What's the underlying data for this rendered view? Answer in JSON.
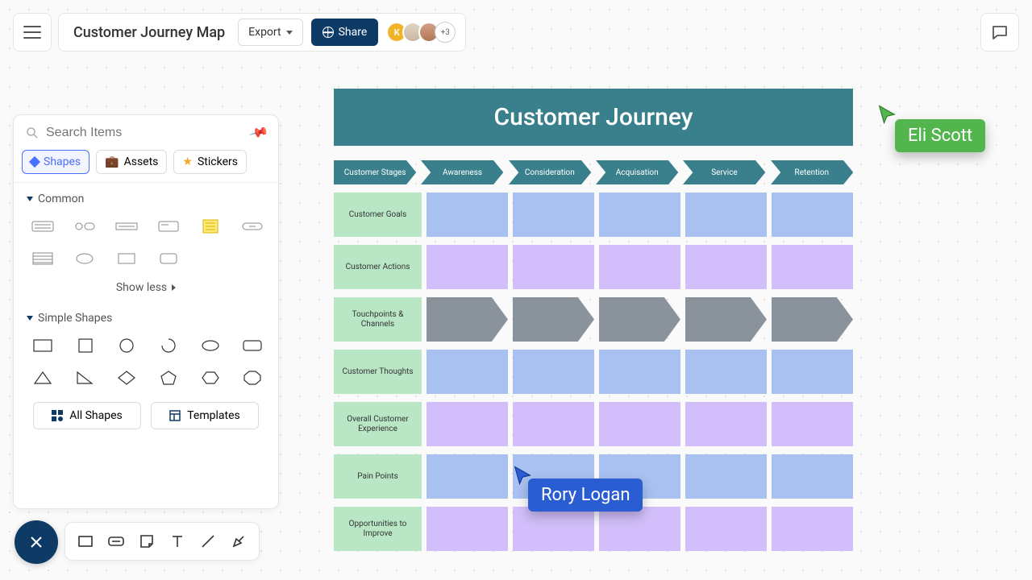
{
  "header": {
    "doc_title": "Customer Journey Map",
    "export_label": "Export",
    "share_label": "Share",
    "more_count": "+3",
    "avatars": [
      {
        "letter": "K",
        "bg": "#f0b429"
      },
      {
        "letter": "",
        "bg": "#d9cbb8"
      },
      {
        "letter": "",
        "bg": "#c98f73"
      }
    ]
  },
  "sidepanel": {
    "search_placeholder": "Search Items",
    "tabs": {
      "shapes": "Shapes",
      "assets": "Assets",
      "stickers": "Stickers"
    },
    "section_common": "Common",
    "section_simple": "Simple Shapes",
    "show_less": "Show less",
    "all_shapes": "All Shapes",
    "templates": "Templates"
  },
  "canvas": {
    "title": "Customer Journey",
    "stages": [
      "Customer Stages",
      "Awareness",
      "Consideration",
      "Acquisation",
      "Service",
      "Retention"
    ],
    "rows": [
      {
        "label": "Customer Goals",
        "color": "c-blue"
      },
      {
        "label": "Customer Actions",
        "color": "c-purple"
      },
      {
        "label": "Touchpoints & Channels",
        "color": "arrow"
      },
      {
        "label": "Customer Thoughts",
        "color": "c-blue"
      },
      {
        "label": "Overall Customer Experience",
        "color": "c-purple"
      },
      {
        "label": "Pain Points",
        "color": "c-blue"
      },
      {
        "label": "Opportunities to Improve",
        "color": "c-purple"
      }
    ]
  },
  "cursors": {
    "green": "Eli Scott",
    "blue": "Rory Logan"
  }
}
